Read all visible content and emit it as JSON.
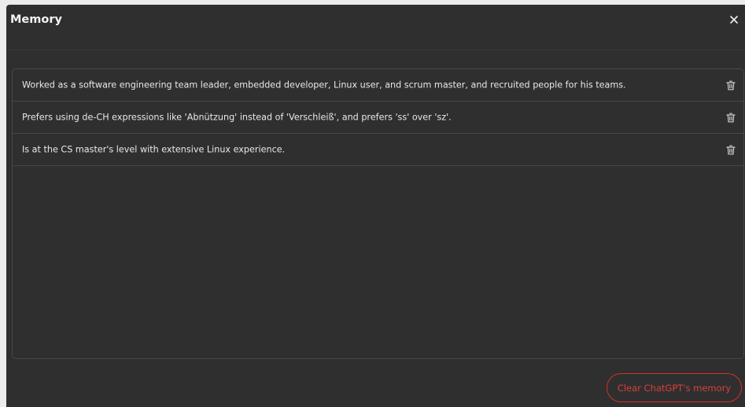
{
  "dialog": {
    "title": "Memory",
    "close_icon": "close-icon"
  },
  "memories": [
    {
      "text": "Worked as a software engineering team leader, embedded developer, Linux user, and scrum master, and recruited people for his teams.",
      "icon": "trash-icon"
    },
    {
      "text": "Prefers using de-CH expressions like 'Abnützung' instead of 'Verschleiß', and prefers 'ss' over 'sz'.",
      "icon": "trash-icon"
    },
    {
      "text": "Is at the CS master's level with extensive Linux experience.",
      "icon": "trash-icon"
    }
  ],
  "footer": {
    "clear_label": "Clear ChatGPT's memory"
  },
  "colors": {
    "background": "#2f2f2f",
    "danger": "#d0312d",
    "text": "#e8e8e8"
  }
}
